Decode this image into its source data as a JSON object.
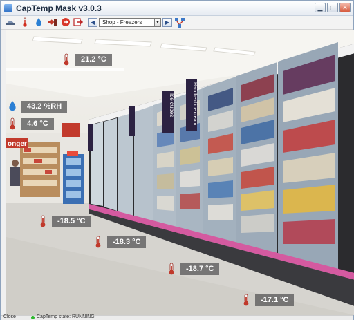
{
  "window": {
    "title": "CapTemp Mask   v3.0.3"
  },
  "toolbar": {
    "tools": [
      {
        "name": "cap-icon"
      },
      {
        "name": "thermometer-icon"
      },
      {
        "name": "drop-icon"
      },
      {
        "name": "import-icon"
      },
      {
        "name": "exit-icon"
      },
      {
        "name": "export-icon"
      }
    ],
    "view_select": "Shop - Freezers",
    "extra_tool": "network-icon"
  },
  "scene": {
    "aisle_signs": [
      "Ice cubes",
      "Handheld ice cream"
    ],
    "store_sign": "onger"
  },
  "sensors": [
    {
      "type": "temperature",
      "value": "21.2 °C"
    },
    {
      "type": "humidity",
      "value": "43.2 %RH"
    },
    {
      "type": "temperature",
      "value": "4.6 °C"
    },
    {
      "type": "temperature",
      "value": "-18.5 °C"
    },
    {
      "type": "temperature",
      "value": "-18.3 °C"
    },
    {
      "type": "temperature",
      "value": "-18.7 °C"
    },
    {
      "type": "temperature",
      "value": "-17.1 °C"
    }
  ],
  "statusbar": {
    "close_label": "Close",
    "state_text": "CapTemp state: RUNNING"
  },
  "colors": {
    "reading_bg": "#606060",
    "thermo_red": "#c0392b",
    "drop_blue": "#2a7fd4"
  }
}
